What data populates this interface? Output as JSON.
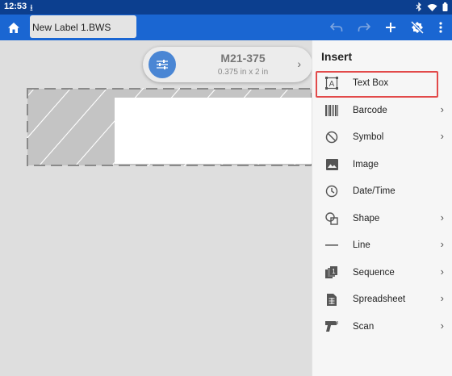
{
  "status_bar": {
    "time": "12:53",
    "download_icon": "download-icon",
    "icons": [
      "bluetooth-icon",
      "wifi-icon",
      "battery-icon"
    ]
  },
  "toolbar": {
    "home_icon": "home-icon",
    "file_name": "New Label 1.BWS",
    "undo_icon": "undo-icon",
    "redo_icon": "redo-icon",
    "add_icon": "plus-icon",
    "print_settings_icon": "printer-off-icon",
    "more_icon": "more-vertical-icon"
  },
  "label": {
    "name": "M21-375",
    "dimensions": "0.375 in x 2 in"
  },
  "insert_panel": {
    "title": "Insert",
    "items": [
      {
        "label": "Text Box",
        "icon": "text-box-icon",
        "has_submenu": false,
        "selected": true
      },
      {
        "label": "Barcode",
        "icon": "barcode-icon",
        "has_submenu": true,
        "selected": false
      },
      {
        "label": "Symbol",
        "icon": "symbol-icon",
        "has_submenu": true,
        "selected": false
      },
      {
        "label": "Image",
        "icon": "image-icon",
        "has_submenu": false,
        "selected": false
      },
      {
        "label": "Date/Time",
        "icon": "clock-icon",
        "has_submenu": false,
        "selected": false
      },
      {
        "label": "Shape",
        "icon": "shape-icon",
        "has_submenu": true,
        "selected": false
      },
      {
        "label": "Line",
        "icon": "line-icon",
        "has_submenu": true,
        "selected": false
      },
      {
        "label": "Sequence",
        "icon": "sequence-icon",
        "has_submenu": true,
        "selected": false
      },
      {
        "label": "Spreadsheet",
        "icon": "spreadsheet-icon",
        "has_submenu": true,
        "selected": false
      },
      {
        "label": "Scan",
        "icon": "scanner-icon",
        "has_submenu": true,
        "selected": false
      }
    ]
  },
  "colors": {
    "status_bar": "#0c3f8f",
    "app_bar": "#1a66d2",
    "settings_button": "#4a86d4",
    "selection_outline": "#e24a4a"
  }
}
